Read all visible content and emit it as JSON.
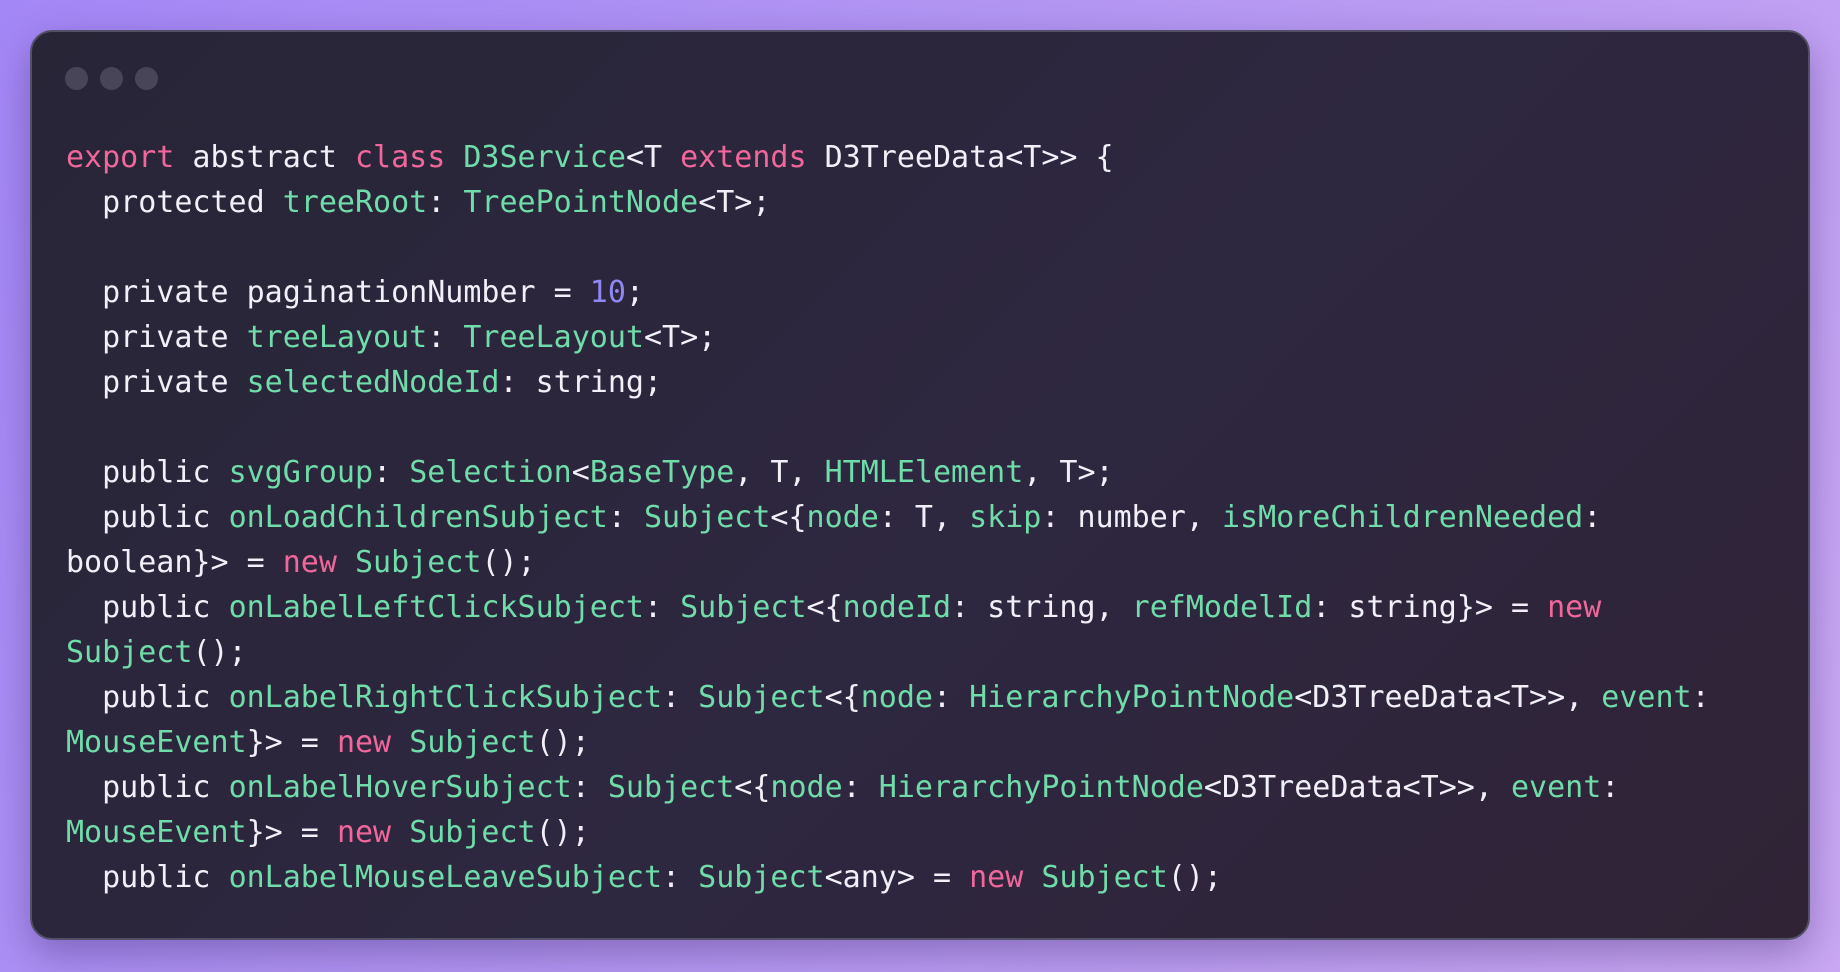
{
  "window": {
    "controls": [
      "dot-1",
      "dot-2",
      "dot-3"
    ]
  },
  "code": {
    "language": "TypeScript",
    "colors": {
      "keyword": "#f0679b",
      "type": "#6fdcaa",
      "number": "#8f88f3",
      "plain": "#f1eff8"
    },
    "lines": [
      [
        [
          "kw",
          "export"
        ],
        [
          "pl",
          " abstract "
        ],
        [
          "kw",
          "class"
        ],
        [
          "pl",
          " "
        ],
        [
          "tp",
          "D3Service"
        ],
        [
          "pl",
          "<T "
        ],
        [
          "kw",
          "extends"
        ],
        [
          "pl",
          " D3TreeData<T>> {"
        ]
      ],
      [
        [
          "pl",
          "  protected "
        ],
        [
          "tp",
          "treeRoot"
        ],
        [
          "pl",
          ": "
        ],
        [
          "tp",
          "TreePointNode"
        ],
        [
          "pl",
          "<T>;"
        ]
      ],
      [],
      [
        [
          "pl",
          "  private paginationNumber = "
        ],
        [
          "num",
          "10"
        ],
        [
          "pl",
          ";"
        ]
      ],
      [
        [
          "pl",
          "  private "
        ],
        [
          "tp",
          "treeLayout"
        ],
        [
          "pl",
          ": "
        ],
        [
          "tp",
          "TreeLayout"
        ],
        [
          "pl",
          "<T>;"
        ]
      ],
      [
        [
          "pl",
          "  private "
        ],
        [
          "tp",
          "selectedNodeId"
        ],
        [
          "pl",
          ": string;"
        ]
      ],
      [],
      [
        [
          "pl",
          "  public "
        ],
        [
          "tp",
          "svgGroup"
        ],
        [
          "pl",
          ": "
        ],
        [
          "tp",
          "Selection"
        ],
        [
          "pl",
          "<"
        ],
        [
          "tp",
          "BaseType"
        ],
        [
          "pl",
          ", T, "
        ],
        [
          "tp",
          "HTMLElement"
        ],
        [
          "pl",
          ", T>;"
        ]
      ],
      [
        [
          "pl",
          "  public "
        ],
        [
          "tp",
          "onLoadChildrenSubject"
        ],
        [
          "pl",
          ": "
        ],
        [
          "tp",
          "Subject"
        ],
        [
          "pl",
          "<{"
        ],
        [
          "tp",
          "node"
        ],
        [
          "pl",
          ": T, "
        ],
        [
          "tp",
          "skip"
        ],
        [
          "pl",
          ": number, "
        ],
        [
          "tp",
          "isMoreChildrenNeeded"
        ],
        [
          "pl",
          ":"
        ]
      ],
      [
        [
          "pl",
          "boolean}> = "
        ],
        [
          "kw",
          "new"
        ],
        [
          "pl",
          " "
        ],
        [
          "tp",
          "Subject"
        ],
        [
          "pl",
          "();"
        ]
      ],
      [
        [
          "pl",
          "  public "
        ],
        [
          "tp",
          "onLabelLeftClickSubject"
        ],
        [
          "pl",
          ": "
        ],
        [
          "tp",
          "Subject"
        ],
        [
          "pl",
          "<{"
        ],
        [
          "tp",
          "nodeId"
        ],
        [
          "pl",
          ": string, "
        ],
        [
          "tp",
          "refModelId"
        ],
        [
          "pl",
          ": string}> = "
        ],
        [
          "kw",
          "new"
        ]
      ],
      [
        [
          "tp",
          "Subject"
        ],
        [
          "pl",
          "();"
        ]
      ],
      [
        [
          "pl",
          "  public "
        ],
        [
          "tp",
          "onLabelRightClickSubject"
        ],
        [
          "pl",
          ": "
        ],
        [
          "tp",
          "Subject"
        ],
        [
          "pl",
          "<{"
        ],
        [
          "tp",
          "node"
        ],
        [
          "pl",
          ": "
        ],
        [
          "tp",
          "HierarchyPointNode"
        ],
        [
          "pl",
          "<D3TreeData<T>>, "
        ],
        [
          "tp",
          "event"
        ],
        [
          "pl",
          ":"
        ]
      ],
      [
        [
          "tp",
          "MouseEvent"
        ],
        [
          "pl",
          "}> = "
        ],
        [
          "kw",
          "new"
        ],
        [
          "pl",
          " "
        ],
        [
          "tp",
          "Subject"
        ],
        [
          "pl",
          "();"
        ]
      ],
      [
        [
          "pl",
          "  public "
        ],
        [
          "tp",
          "onLabelHoverSubject"
        ],
        [
          "pl",
          ": "
        ],
        [
          "tp",
          "Subject"
        ],
        [
          "pl",
          "<{"
        ],
        [
          "tp",
          "node"
        ],
        [
          "pl",
          ": "
        ],
        [
          "tp",
          "HierarchyPointNode"
        ],
        [
          "pl",
          "<D3TreeData<T>>, "
        ],
        [
          "tp",
          "event"
        ],
        [
          "pl",
          ":"
        ]
      ],
      [
        [
          "tp",
          "MouseEvent"
        ],
        [
          "pl",
          "}> = "
        ],
        [
          "kw",
          "new"
        ],
        [
          "pl",
          " "
        ],
        [
          "tp",
          "Subject"
        ],
        [
          "pl",
          "();"
        ]
      ],
      [
        [
          "pl",
          "  public "
        ],
        [
          "tp",
          "onLabelMouseLeaveSubject"
        ],
        [
          "pl",
          ": "
        ],
        [
          "tp",
          "Subject"
        ],
        [
          "pl",
          "<any> = "
        ],
        [
          "kw",
          "new"
        ],
        [
          "pl",
          " "
        ],
        [
          "tp",
          "Subject"
        ],
        [
          "pl",
          "();"
        ]
      ]
    ]
  }
}
